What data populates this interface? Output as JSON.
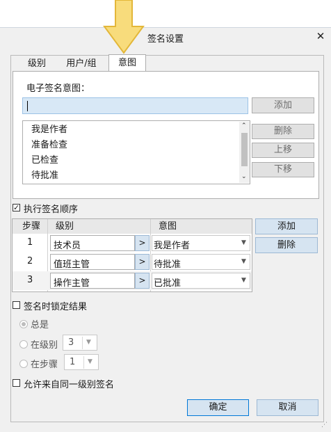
{
  "dialog": {
    "title": "签名设置"
  },
  "tabs": [
    {
      "label": "级别"
    },
    {
      "label": "用户/组"
    },
    {
      "label": "意图"
    }
  ],
  "intent": {
    "label": "电子签名意图：",
    "input_value": "",
    "add_label": "添加",
    "delete_label": "删除",
    "up_label": "上移",
    "down_label": "下移",
    "items": [
      "我是作者",
      "准备检查",
      "已检查",
      "待批准"
    ]
  },
  "enforce_order": {
    "label": "执行签名顺序",
    "checked": true
  },
  "table": {
    "columns": [
      "步骤",
      "级别",
      "意图"
    ],
    "rows": [
      {
        "step": "1",
        "level": "技术员",
        "intent": "我是作者"
      },
      {
        "step": "2",
        "level": "值班主管",
        "intent": "待批准"
      },
      {
        "step": "3",
        "level": "操作主管",
        "intent": "已批准"
      }
    ],
    "arrow_label": ">",
    "add_label": "添加",
    "delete_label": "删除"
  },
  "lock": {
    "label": "签名时锁定结果",
    "checked": false,
    "options": [
      {
        "label": "总是",
        "selected": true
      },
      {
        "label": "在级别",
        "value": "3"
      },
      {
        "label": "在步骤",
        "value": "1"
      }
    ]
  },
  "allow_same_level": {
    "label": "允许来自同一级别签名",
    "checked": false
  },
  "footer": {
    "ok_label": "确定",
    "cancel_label": "取消"
  },
  "colors": {
    "accent": "#0078d7",
    "arrow_fill": "#f8dc7c",
    "arrow_stroke": "#e3b739"
  },
  "icons": {
    "close": "close-icon",
    "pointer": "arrow-down-icon",
    "resize": "resize-grip-icon"
  }
}
